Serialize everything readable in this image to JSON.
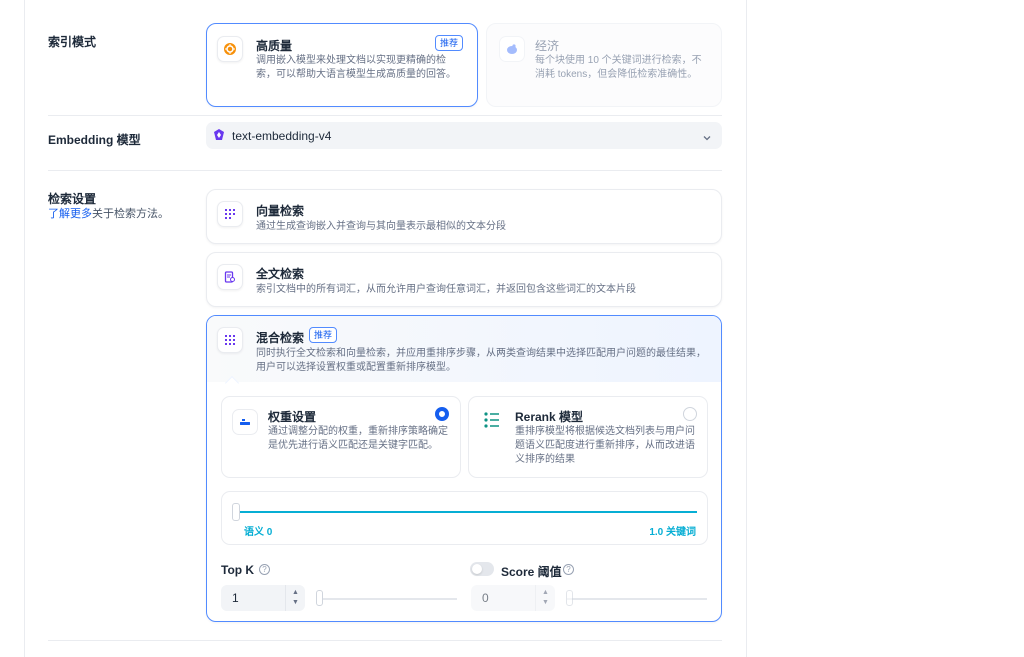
{
  "index_mode": {
    "label": "索引模式",
    "high_quality": {
      "title": "高质量",
      "badge": "推荐",
      "desc": "调用嵌入模型来处理文档以实现更精确的检索，可以帮助大语言模型生成高质量的回答。"
    },
    "economy": {
      "title": "经济",
      "desc": "每个块使用 10 个关键词进行检索，不消耗 tokens，但会降低检索准确性。"
    }
  },
  "embedding": {
    "label": "Embedding 模型",
    "value": "text-embedding-v4"
  },
  "retrieval": {
    "label": "检索设置",
    "learn_more_link": "了解更多",
    "learn_more_suffix": "关于检索方法。",
    "vector": {
      "title": "向量检索",
      "desc": "通过生成查询嵌入并查询与其向量表示最相似的文本分段"
    },
    "fulltext": {
      "title": "全文检索",
      "desc": "索引文档中的所有词汇，从而允许用户查询任意词汇，并返回包含这些词汇的文本片段"
    },
    "hybrid": {
      "title": "混合检索",
      "badge": "推荐",
      "desc": "同时执行全文检索和向量检索，并应用重排序步骤，从两类查询结果中选择匹配用户问题的最佳结果，用户可以选择设置权重或配置重新排序模型。",
      "weight": {
        "title": "权重设置",
        "desc": "通过调整分配的权重，重新排序策略确定是优先进行语义匹配还是关键字匹配。",
        "selected": true
      },
      "rerank": {
        "title": "Rerank 模型",
        "desc": "重排序模型将根据候选文档列表与用户问题语义匹配度进行重新排序，从而改进语义排序的结果",
        "selected": false
      },
      "slider": {
        "left_label": "语义 0",
        "right_label": "1.0 关键词",
        "semantic_weight": 0
      },
      "top_k": {
        "label": "Top K",
        "value": "1"
      },
      "score": {
        "label": "Score 阈值",
        "value": "0",
        "enabled": false
      }
    }
  },
  "colors": {
    "accent": "#155eef",
    "selected_border": "#528bff",
    "slider": "#06aed4",
    "high_quality_icon": "#f79009",
    "purple_icon": "#6938ef"
  }
}
